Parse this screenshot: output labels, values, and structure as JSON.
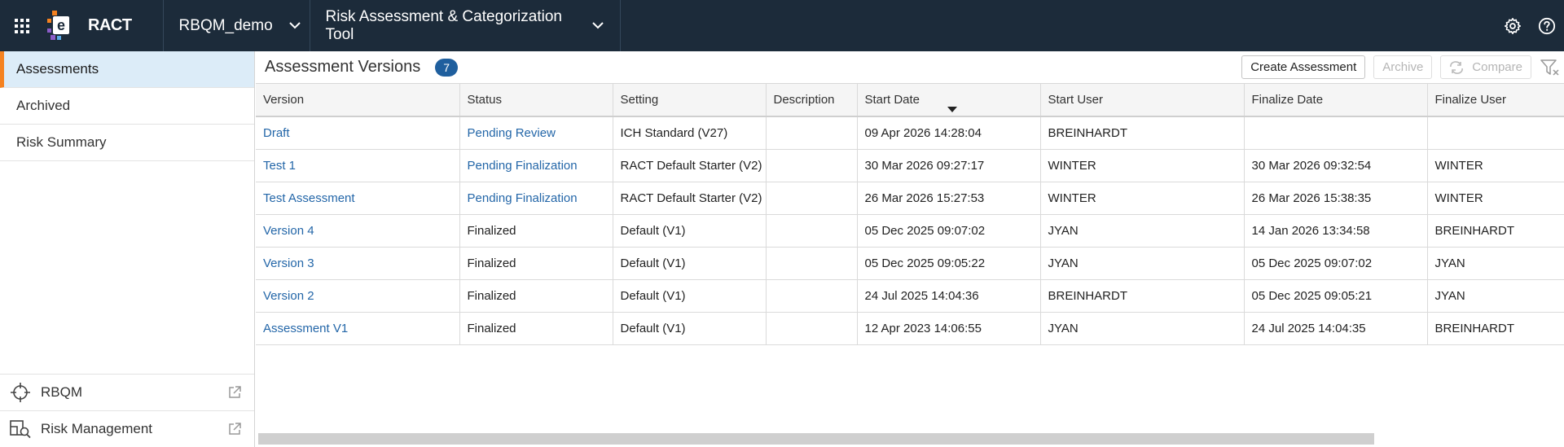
{
  "header": {
    "app_name": "RACT",
    "context": "RBQM_demo",
    "tool": "Risk Assessment & Categorization Tool"
  },
  "sidebar": {
    "items": [
      {
        "label": "Assessments",
        "active": true
      },
      {
        "label": "Archived",
        "active": false
      },
      {
        "label": "Risk Summary",
        "active": false
      }
    ],
    "external": [
      {
        "label": "RBQM",
        "icon": "crosshair-icon"
      },
      {
        "label": "Risk Management",
        "icon": "risk-management-icon"
      }
    ]
  },
  "main": {
    "title": "Assessment Versions",
    "count": "7",
    "buttons": {
      "create": "Create Assessment",
      "archive": "Archive",
      "compare": "Compare"
    },
    "columns": [
      "Version",
      "Status",
      "Setting",
      "Description",
      "Start Date",
      "Start User",
      "Finalize Date",
      "Finalize User"
    ],
    "sort_column": "Start Date",
    "rows": [
      {
        "version": "Draft",
        "status": "Pending Review",
        "setting": "ICH Standard (V27)",
        "description": "",
        "start_date": "09 Apr 2026 14:28:04",
        "start_user": "BREINHARDT",
        "finalize_date": "",
        "finalize_user": ""
      },
      {
        "version": "Test 1",
        "status": "Pending Finalization",
        "setting": "RACT Default Starter (V2)",
        "description": "",
        "start_date": "30 Mar 2026 09:27:17",
        "start_user": "WINTER",
        "finalize_date": "30 Mar 2026 09:32:54",
        "finalize_user": "WINTER"
      },
      {
        "version": "Test Assessment",
        "status": "Pending Finalization",
        "setting": "RACT Default Starter (V2)",
        "description": "",
        "start_date": "26 Mar 2026 15:27:53",
        "start_user": "WINTER",
        "finalize_date": "26 Mar 2026 15:38:35",
        "finalize_user": "WINTER"
      },
      {
        "version": "Version 4",
        "status": "Finalized",
        "setting": "Default (V1)",
        "description": "",
        "start_date": "05 Dec 2025 09:07:02",
        "start_user": "JYAN",
        "finalize_date": "14 Jan 2026 13:34:58",
        "finalize_user": "BREINHARDT"
      },
      {
        "version": "Version 3",
        "status": "Finalized",
        "setting": "Default (V1)",
        "description": "",
        "start_date": "05 Dec 2025 09:05:22",
        "start_user": "JYAN",
        "finalize_date": "05 Dec 2025 09:07:02",
        "finalize_user": "JYAN"
      },
      {
        "version": "Version 2",
        "status": "Finalized",
        "setting": "Default (V1)",
        "description": "",
        "start_date": "24 Jul 2025 14:04:36",
        "start_user": "BREINHARDT",
        "finalize_date": "05 Dec 2025 09:05:21",
        "finalize_user": "JYAN"
      },
      {
        "version": "Assessment V1",
        "status": "Finalized",
        "setting": "Default (V1)",
        "description": "",
        "start_date": "12 Apr 2023 14:06:55",
        "start_user": "JYAN",
        "finalize_date": "24 Jul 2025 14:04:35",
        "finalize_user": "BREINHARDT"
      }
    ]
  },
  "colors": {
    "topbar": "#1c2b3a",
    "accent": "#f58220",
    "link": "#2366a8",
    "badge": "#1f5f9e",
    "active_nav": "#dcecf8"
  }
}
